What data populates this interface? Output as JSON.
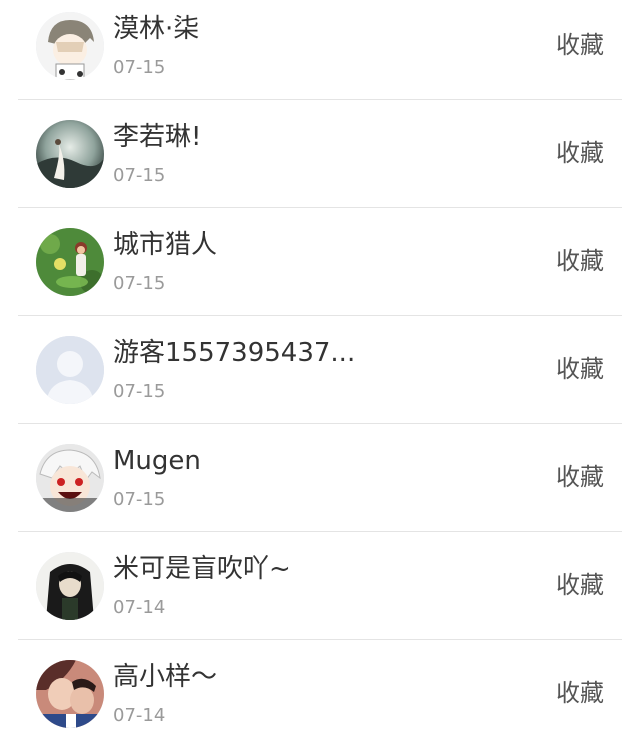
{
  "items": [
    {
      "name": "漠林·柒",
      "date": "07-15",
      "action": "收藏",
      "avatar_icon": "cartoon-face-icon"
    },
    {
      "name": "李若琳!",
      "date": "07-15",
      "action": "收藏",
      "avatar_icon": "landscape-photo-icon"
    },
    {
      "name": "城市猎人",
      "date": "07-15",
      "action": "收藏",
      "avatar_icon": "game-character-icon"
    },
    {
      "name": "游客1557395437...",
      "date": "07-15",
      "action": "收藏",
      "avatar_icon": "default-user-icon"
    },
    {
      "name": "Mugen",
      "date": "07-15",
      "action": "收藏",
      "avatar_icon": "anime-face-icon"
    },
    {
      "name": "米可是盲吹吖~",
      "date": "07-14",
      "action": "收藏",
      "avatar_icon": "portrait-photo-icon"
    },
    {
      "name": "高小样～",
      "date": "07-14",
      "action": "收藏",
      "avatar_icon": "couple-photo-icon"
    }
  ],
  "colors": {
    "name_text": "#333333",
    "date_text": "#9a9a9a",
    "action_text": "#555555",
    "divider": "#e4e4e4"
  }
}
